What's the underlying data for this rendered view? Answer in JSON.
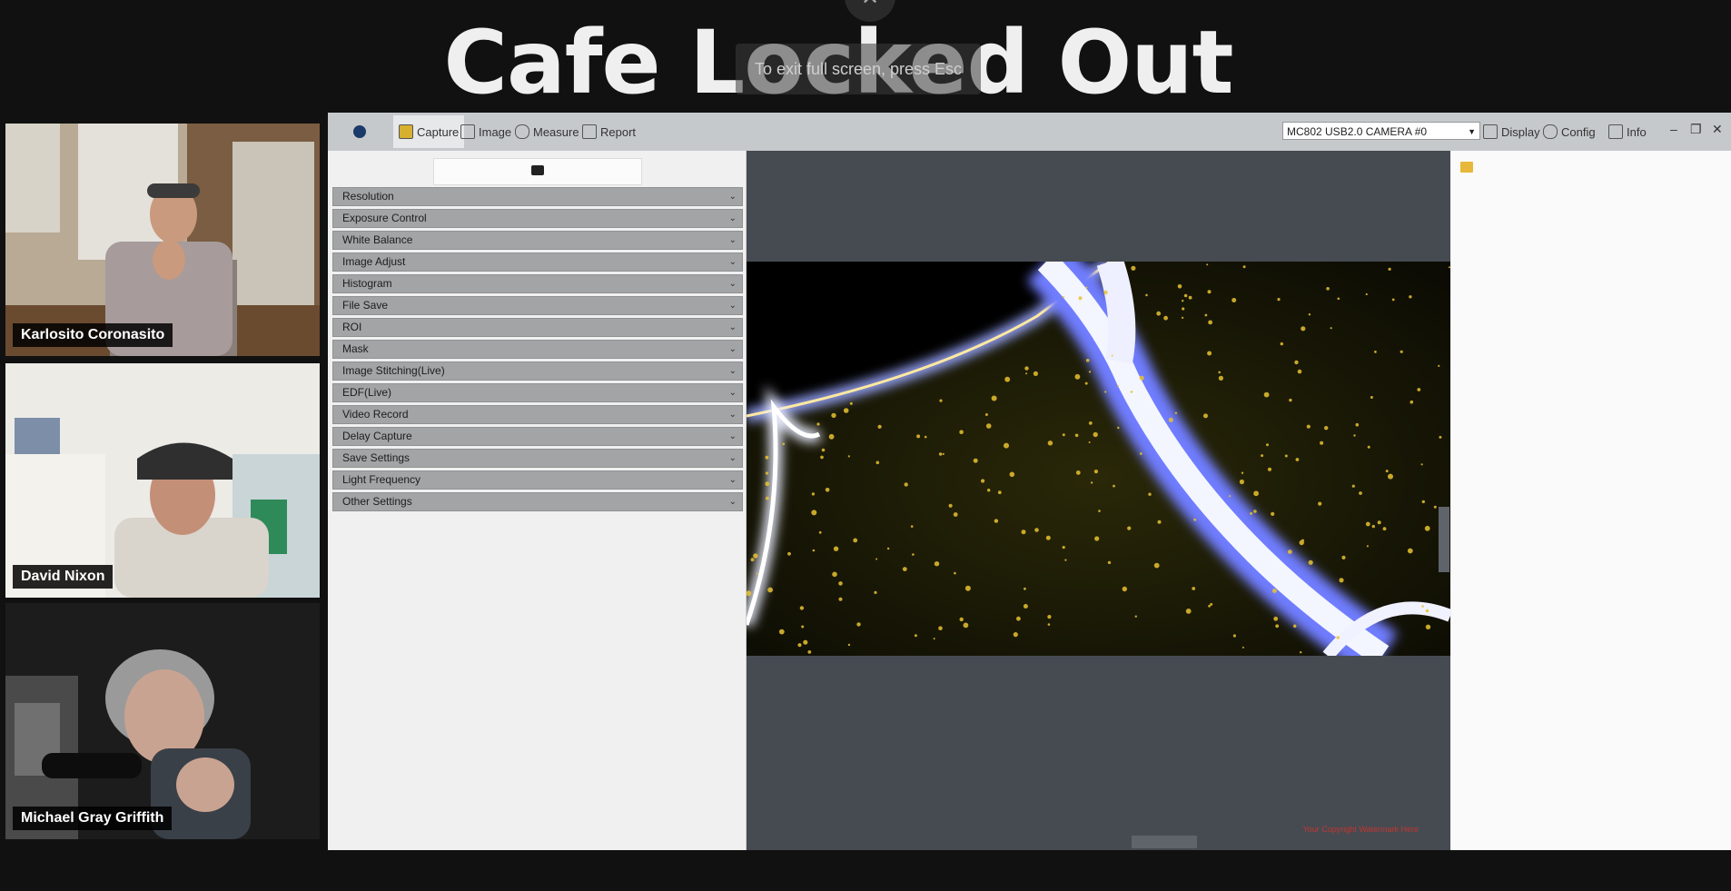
{
  "title": "Cafe Locked Out",
  "fullscreen_hint": "To exit full screen, press Esc",
  "participants": [
    {
      "name": "Karlosito Coronasito"
    },
    {
      "name": "David Nixon"
    },
    {
      "name": "Michael Gray Griffith"
    }
  ],
  "app": {
    "tabs": [
      {
        "label": "Capture",
        "icon": "capture-icon",
        "active": true
      },
      {
        "label": "Image",
        "icon": "image-icon"
      },
      {
        "label": "Measure",
        "icon": "measure-icon"
      },
      {
        "label": "Report",
        "icon": "report-icon"
      }
    ],
    "camera": "MC802 USB2.0 CAMERA #0",
    "right_tools": [
      {
        "label": "Display",
        "icon": "display-icon"
      },
      {
        "label": "Config",
        "icon": "config-icon"
      },
      {
        "label": "Info",
        "icon": "info-icon"
      }
    ],
    "panels": [
      "Resolution",
      "Exposure Control",
      "White Balance",
      "Image Adjust",
      "Histogram",
      "File Save",
      "ROI",
      "Mask",
      "Image Stitching(Live)",
      "EDF(Live)",
      "Video Record",
      "Delay Capture",
      "Save Settings",
      "Light Frequency",
      "Other Settings"
    ],
    "copyright": "Your Copyright Watermark Here"
  },
  "colors": {
    "background": "#111111",
    "toolbar": "#c6c9cc",
    "panel_header": "#a2a4a6",
    "viewer": "#464b52"
  }
}
